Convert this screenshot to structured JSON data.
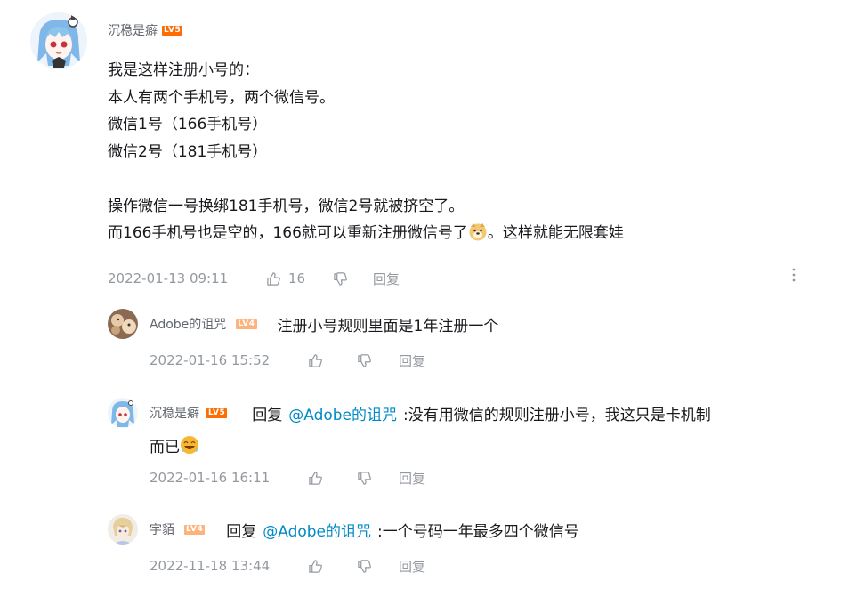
{
  "main_comment": {
    "username": "沉稳是癖",
    "level": "LV5",
    "level_color": "#ff6c00",
    "lines": [
      "我是这样注册小号的：",
      "本人有两个手机号，两个微信号。",
      "微信1号（166手机号）",
      "微信2号（181手机号）",
      "",
      "操作微信一号换绑181手机号，微信2号就被挤空了。"
    ],
    "last_line_before": "而166手机号也是空的，166就可以重新注册微信号了",
    "last_line_after": "。这样就能无限套娃",
    "emoji": "doge-emoji",
    "time": "2022-01-13 09:11",
    "likes": "16",
    "reply_label": "回复"
  },
  "replies": [
    {
      "username": "Adobe的诅咒",
      "level": "LV4",
      "level_color": "#ffb37c",
      "text": "注册小号规则里面是1年注册一个",
      "time": "2022-01-16 15:52",
      "reply_label": "回复"
    },
    {
      "username": "沉稳是癖",
      "level": "LV5",
      "level_color": "#ff6c00",
      "reply_prefix": "回复",
      "mention": "@Adobe的诅咒",
      "text": ":没有用微信的规则注册小号，我这只是卡机制",
      "text_line2": "而已",
      "emoji": "laughing-emoji",
      "time": "2022-01-16 16:11",
      "reply_label": "回复"
    },
    {
      "username": "宇貊",
      "level": "LV4",
      "level_color": "#ffb37c",
      "reply_prefix": "回复",
      "mention": "@Adobe的诅咒",
      "text": ":一个号码一年最多四个微信号",
      "time": "2022-11-18 13:44",
      "reply_label": "回复"
    }
  ],
  "icons": {
    "like": "thumb-up-icon",
    "dislike": "thumb-down-icon",
    "more": "more-vertical-icon"
  },
  "colors": {
    "mention": "#008ac5",
    "meta": "#9499a0",
    "text": "#18191c"
  }
}
